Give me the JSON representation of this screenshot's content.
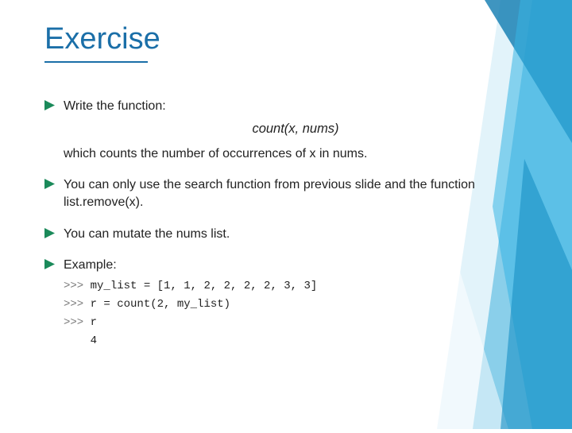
{
  "title": "Exercise",
  "bullets": {
    "b1": "Write the function:",
    "func_sig": "count(x, nums)",
    "b1_sub": "which counts the number of occurrences of x in nums.",
    "b2": "You can only use the search function from previous slide and the function list.remove(x).",
    "b3": "You can mutate the nums list.",
    "b4": "Example:"
  },
  "code": {
    "prompt": ">>>",
    "l1": "my_list = [1, 1, 2, 2, 2, 2, 3, 3]",
    "l2": "r = count(2, my_list)",
    "l3": "r",
    "l4": "4"
  }
}
